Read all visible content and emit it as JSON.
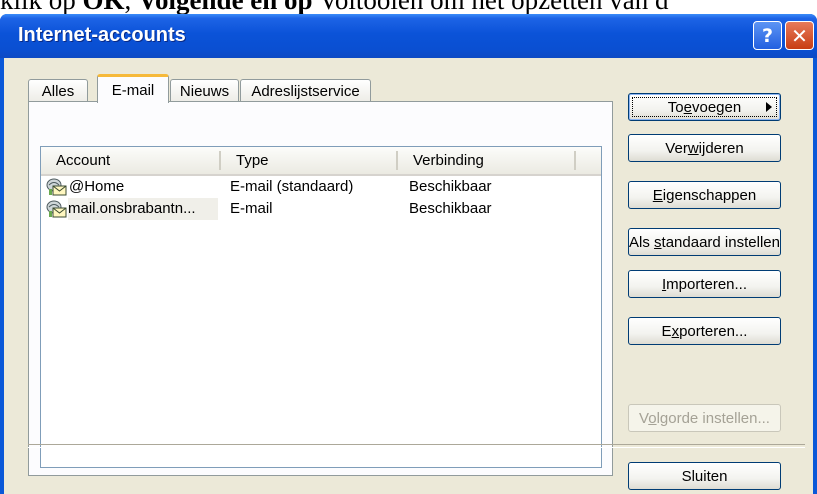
{
  "doc_text": {
    "prefix": "klik op ",
    "ok": "OK",
    "mid": ", ",
    "bold": "Volgende en op",
    "rest": " Voltooien om het opzetten van d"
  },
  "window": {
    "title": "Internet-accounts",
    "help_label": "?",
    "close_label": "✕"
  },
  "tabs": [
    {
      "label": "Alles"
    },
    {
      "label": "E-mail",
      "active": true
    },
    {
      "label": "Nieuws"
    },
    {
      "label": "Adreslijstservice"
    }
  ],
  "list": {
    "columns": [
      "Account",
      "Type",
      "Verbinding"
    ],
    "rows": [
      {
        "account": "@Home",
        "type": "E-mail (standaard)",
        "connection": "Beschikbaar",
        "icon": "mail-account-icon"
      },
      {
        "account": "mail.onsbrabantn...",
        "type": "E-mail",
        "connection": "Beschikbaar",
        "icon": "mail-account-icon"
      }
    ]
  },
  "buttons": {
    "add": {
      "pre": "To",
      "ul": "e",
      "post": "voegen"
    },
    "remove": {
      "pre": "Ver",
      "ul": "w",
      "post": "ijderen"
    },
    "properties": {
      "pre": "",
      "ul": "E",
      "post": "igenschappen"
    },
    "set_default": {
      "pre": "Als ",
      "ul": "s",
      "post": "tandaard instellen"
    },
    "import": {
      "pre": "",
      "ul": "I",
      "post": "mporteren..."
    },
    "export": {
      "pre": "E",
      "ul": "x",
      "post": "porteren..."
    },
    "order": {
      "pre": "V",
      "ul": "o",
      "post": "lgorde instellen..."
    },
    "close": {
      "label": "Sluiten"
    }
  },
  "colors": {
    "titlebar": "#0a53d8",
    "dialog_bg": "#ece9d8",
    "active_tab_accent": "#f6b93a"
  }
}
